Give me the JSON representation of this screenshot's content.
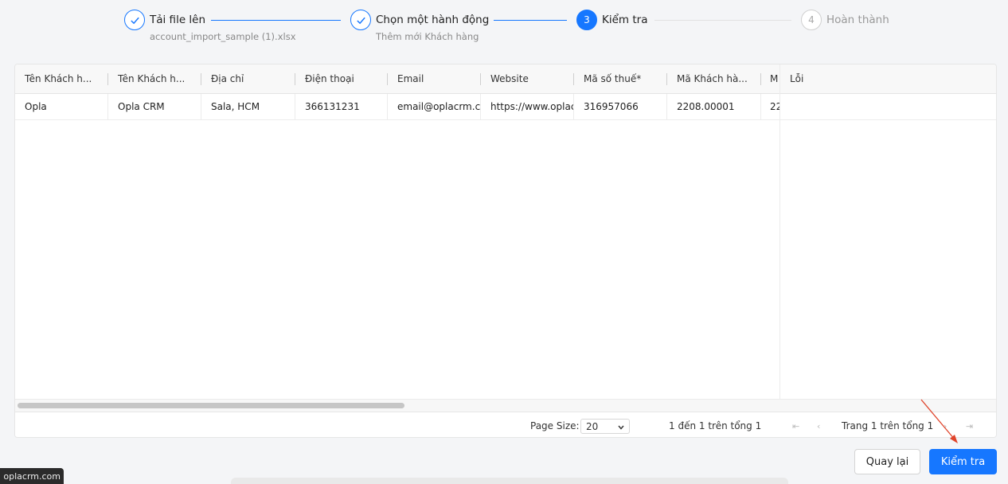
{
  "steps": [
    {
      "icon": "check-icon",
      "title": "Tải file lên",
      "desc": "account_import_sample (1).xlsx",
      "state": "done"
    },
    {
      "icon": "check-icon",
      "title": "Chọn một hành động",
      "desc": "Thêm mới Khách hàng",
      "state": "done"
    },
    {
      "number": "3",
      "title": "Kiểm tra",
      "state": "active"
    },
    {
      "number": "4",
      "title": "Hoàn thành",
      "state": "wait"
    }
  ],
  "table": {
    "columns": [
      "Tên Khách h...",
      "Tên Khách h...",
      "Địa chỉ",
      "Điện thoại",
      "Email",
      "Website",
      "Mã số thuế*",
      "Mã Khách hà...",
      "M",
      "Lỗi"
    ],
    "rows": [
      [
        "Opla",
        "Opla CRM",
        "Sala, HCM",
        "366131231",
        "email@oplacrm.co",
        "https://www.oplacr",
        "316957066",
        "2208.00001",
        "22",
        ""
      ]
    ]
  },
  "pager": {
    "page_size_label": "Page Size:",
    "page_size_value": "20",
    "range_text": "1 đến 1 trên tổng 1",
    "page_text": "Trang 1 trên tổng 1"
  },
  "buttons": {
    "back": "Quay lại",
    "check": "Kiểm tra"
  },
  "url_tooltip": "oplacrm.com",
  "colors": {
    "primary": "#1677ff",
    "annotation_arrow": "#e0442b"
  }
}
